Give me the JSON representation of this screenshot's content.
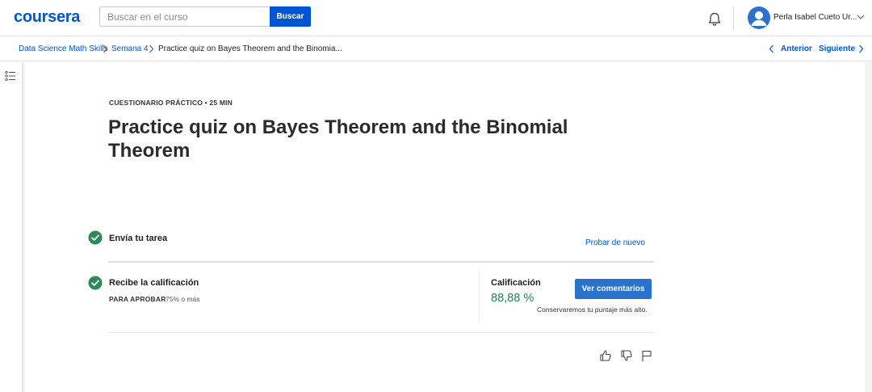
{
  "header": {
    "logo": "coursera",
    "search_placeholder": "Buscar en el curso",
    "search_button": "Buscar",
    "user_name": "Perla Isabel Cueto Ur...",
    "icons": [
      "bell-icon",
      "avatar-person-icon",
      "chevron-down-icon"
    ]
  },
  "breadcrumb": {
    "items": [
      "Data Science Math Skills",
      "Semana 4",
      "Practice quiz on Bayes Theorem and the Binomia..."
    ],
    "prev_label": "Anterior",
    "next_label": "Siguiente"
  },
  "quiz": {
    "eyebrow": "CUESTIONARIO PRÁCTICO • 25 MIN",
    "title": "Practice quiz on Bayes Theorem and the Binomial Theorem",
    "step1": {
      "title": "Envía tu tarea",
      "action": "Probar de nuevo"
    },
    "step2": {
      "title": "Recibe la calificación",
      "pass_label": "PARA APROBAR",
      "pass_value": "75% o más",
      "grade_label": "Calificación",
      "grade_value": "88,88 %",
      "feedback_button": "Ver comentarios",
      "keep_note": "Conservaremos tu puntaje más alto."
    }
  },
  "colors": {
    "brand_blue": "#0056d2",
    "button_blue": "#2a73cc",
    "success_green": "#1f8354",
    "check_green": "#2d8a5a"
  }
}
